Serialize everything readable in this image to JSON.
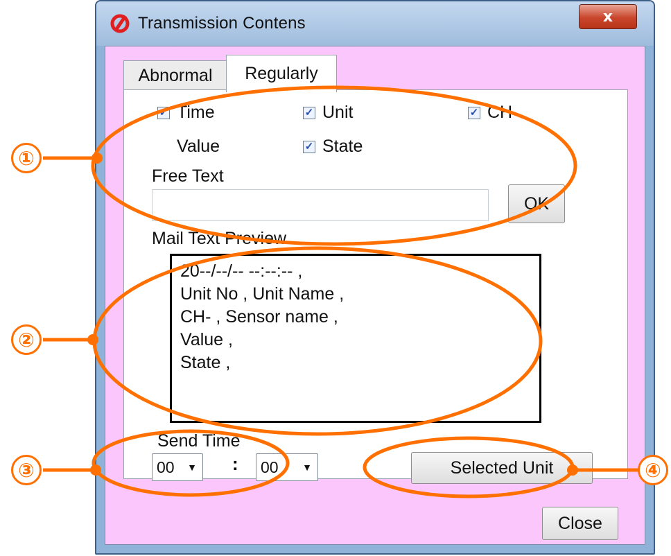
{
  "window": {
    "title": "Transmission Contens",
    "close_glyph": "x",
    "title_icon": "app-logo-icon",
    "client_background": "#fbc6fb",
    "annotation_color": "#ff7000"
  },
  "tabs": [
    {
      "label": "Abnormal",
      "selected": false
    },
    {
      "label": "Regularly",
      "selected": true
    }
  ],
  "fields": {
    "time": {
      "label": "Time",
      "checked": true
    },
    "unit": {
      "label": "Unit",
      "checked": true
    },
    "ch": {
      "label": "CH",
      "checked": true
    },
    "value": {
      "label": "Value"
    },
    "state": {
      "label": "State",
      "checked": true
    }
  },
  "free_text": {
    "label": "Free Text",
    "value": "",
    "ok_label": "OK"
  },
  "preview": {
    "label": "Mail Text Preview",
    "lines": [
      "20--/--/-- --:--:-- ,",
      "Unit No , Unit Name ,",
      "CH- , Sensor name ,",
      "Value ,",
      "State ,"
    ]
  },
  "send_time": {
    "label": "Send Time",
    "hour": "00",
    "separator": ":",
    "minute": "00"
  },
  "selected_unit_label": "Selected Unit",
  "close_label": "Close",
  "annotations": [
    "①",
    "②",
    "③",
    "④"
  ]
}
